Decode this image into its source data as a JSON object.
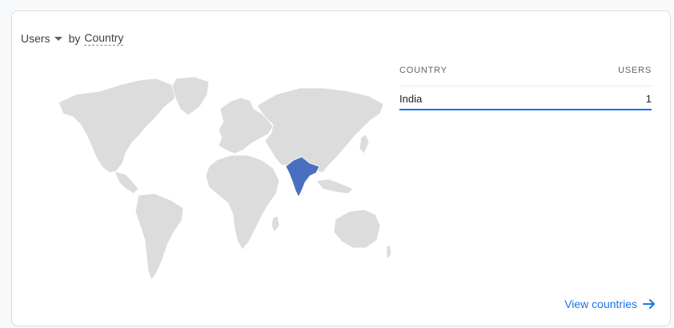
{
  "header": {
    "metric": "Users",
    "by": "by",
    "dimension": "Country"
  },
  "table": {
    "col_country": "COUNTRY",
    "col_users": "USERS",
    "rows": [
      {
        "country": "India",
        "users": "1"
      }
    ]
  },
  "link": {
    "label": "View countries"
  },
  "colors": {
    "land": "#dcdcdc",
    "highlight": "#4a6fbf",
    "accent": "#1a73e8",
    "border": "#ffffff"
  },
  "icons": {
    "caret": "caret-down-icon",
    "arrow": "arrow-right-icon"
  }
}
